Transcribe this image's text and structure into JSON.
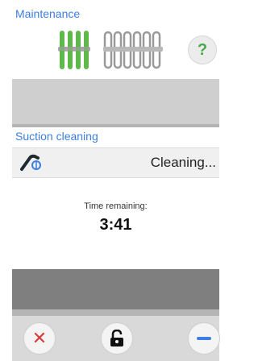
{
  "maintenance": {
    "title": "Maintenance",
    "icons": [
      "heating-element-green-icon",
      "heating-element-grey-icon"
    ],
    "help_label": "?"
  },
  "suction": {
    "title": "Suction cleaning",
    "icon": "suction-nozzle-icon",
    "status": "Cleaning...",
    "remaining_label": "Time remaining:",
    "remaining_value": "3:41"
  },
  "bottom": {
    "cancel_label": "✕",
    "lock_icon": "unlock-icon",
    "minus_icon": "minus-icon"
  },
  "colors": {
    "title_blue": "#3d7ee0",
    "accent_green": "#49a94a",
    "cancel_red": "#d93b3b"
  }
}
